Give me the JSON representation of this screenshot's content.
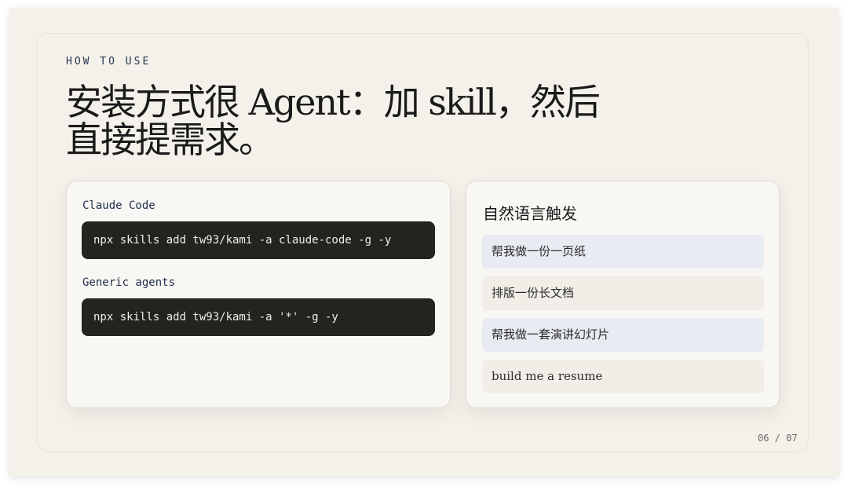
{
  "slide": {
    "eyebrow": "HOW TO USE",
    "title_line1": "安装方式很 Agent：加 skill，然后",
    "title_line2": "直接提需求。",
    "page_indicator": "06 / 07"
  },
  "install": {
    "claude_label": "Claude Code",
    "claude_command": "npx skills add tw93/kami -a claude-code -g -y",
    "generic_label": "Generic agents",
    "generic_command": "npx skills add tw93/kami -a '*' -g -y"
  },
  "natural_language": {
    "title": "自然语言触发",
    "prompts": [
      "帮我做一份一页纸",
      "排版一份长文档",
      "帮我做一套演讲幻灯片",
      "build me a resume"
    ]
  },
  "colors": {
    "background": "#f3f1ea",
    "card": "#f8f7f3",
    "code_block": "#232320",
    "prompt_blue": "#e8ebf1",
    "prompt_beige": "#f0eee7"
  }
}
